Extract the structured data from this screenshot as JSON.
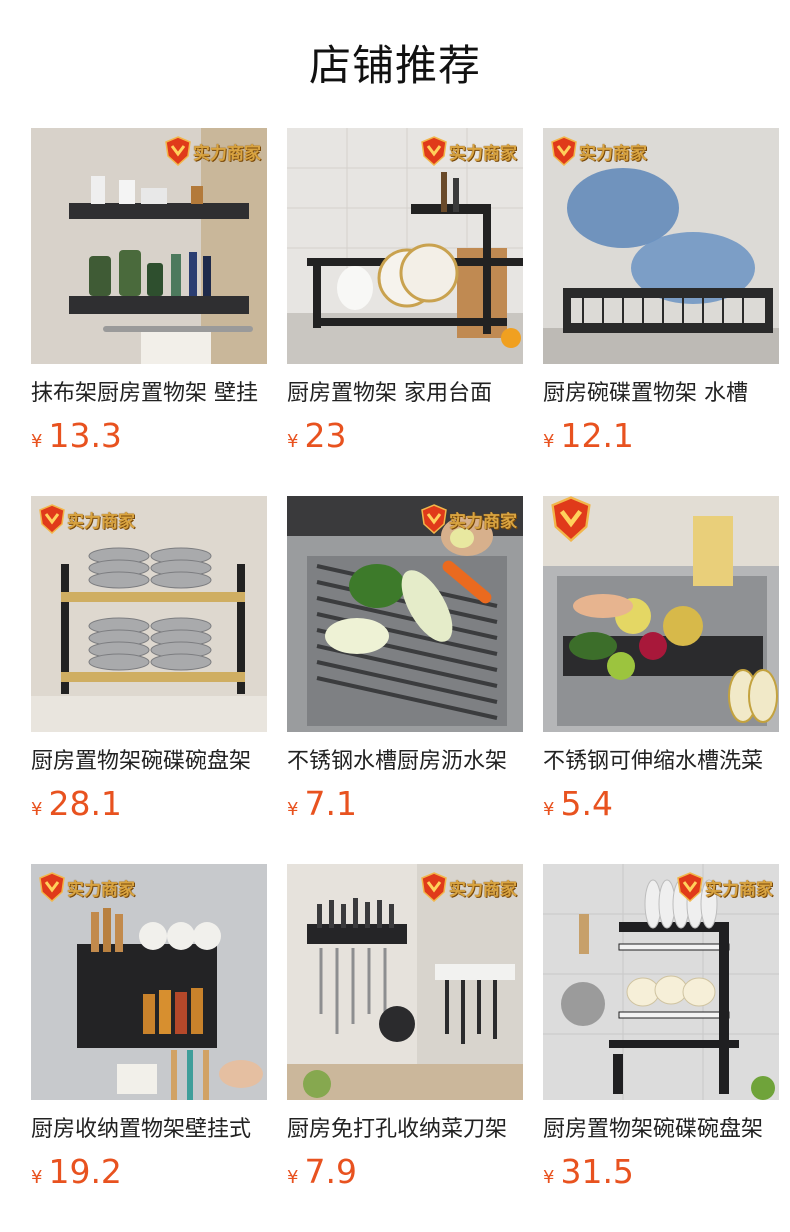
{
  "section": {
    "title": "店铺推荐"
  },
  "badge_text": "实力商家",
  "colors": {
    "price": "#e8521f",
    "badge_red": "#e03a1a",
    "badge_gold": "#d9a441"
  },
  "products": [
    {
      "name": "抹布架厨房置物架 壁挂",
      "currency": "¥",
      "price": "13.3",
      "badge": true
    },
    {
      "name": "厨房置物架 家用台面",
      "currency": "¥",
      "price": "23",
      "badge": true
    },
    {
      "name": "厨房碗碟置物架 水槽",
      "currency": "¥",
      "price": "12.1",
      "badge": true
    },
    {
      "name": "厨房置物架碗碟碗盘架",
      "currency": "¥",
      "price": "28.1",
      "badge": true
    },
    {
      "name": "不锈钢水槽厨房沥水架",
      "currency": "¥",
      "price": "7.1",
      "badge": true
    },
    {
      "name": "不锈钢可伸缩水槽洗菜",
      "currency": "¥",
      "price": "5.4",
      "badge": false
    },
    {
      "name": "厨房收纳置物架壁挂式",
      "currency": "¥",
      "price": "19.2",
      "badge": true
    },
    {
      "name": "厨房免打孔收纳菜刀架",
      "currency": "¥",
      "price": "7.9",
      "badge": true
    },
    {
      "name": "厨房置物架碗碟碗盘架",
      "currency": "¥",
      "price": "31.5",
      "badge": true
    }
  ]
}
